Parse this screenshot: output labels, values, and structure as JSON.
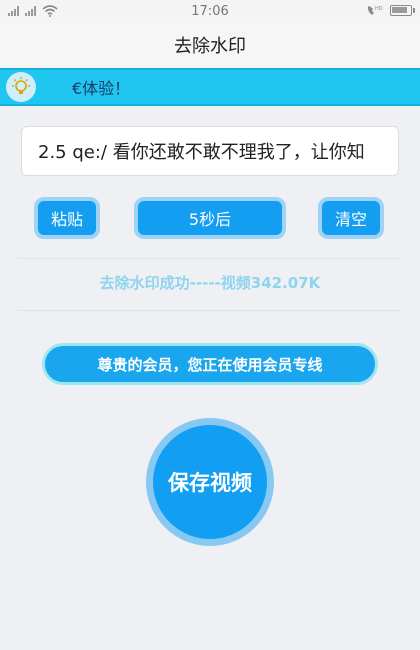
{
  "status_bar": {
    "time": "17:06"
  },
  "header": {
    "title": "去除水印"
  },
  "notice": {
    "text": "€体验！"
  },
  "input": {
    "value": "2.5 qe:/ 看你还敢不敢不理我了，让你知"
  },
  "buttons": {
    "paste": "粘贴",
    "timer": "5秒后",
    "clear": "清空"
  },
  "result": {
    "text": "去除水印成功-----视频342.07K"
  },
  "member": {
    "text": "尊贵的会员，您正在使用会员专线"
  },
  "save": {
    "label": "保存视频"
  },
  "colors": {
    "accent": "#149ef2",
    "notice_bg": "#1ec6f0",
    "result_text": "#8ed4ee",
    "button_border": "#9fd3f6"
  }
}
